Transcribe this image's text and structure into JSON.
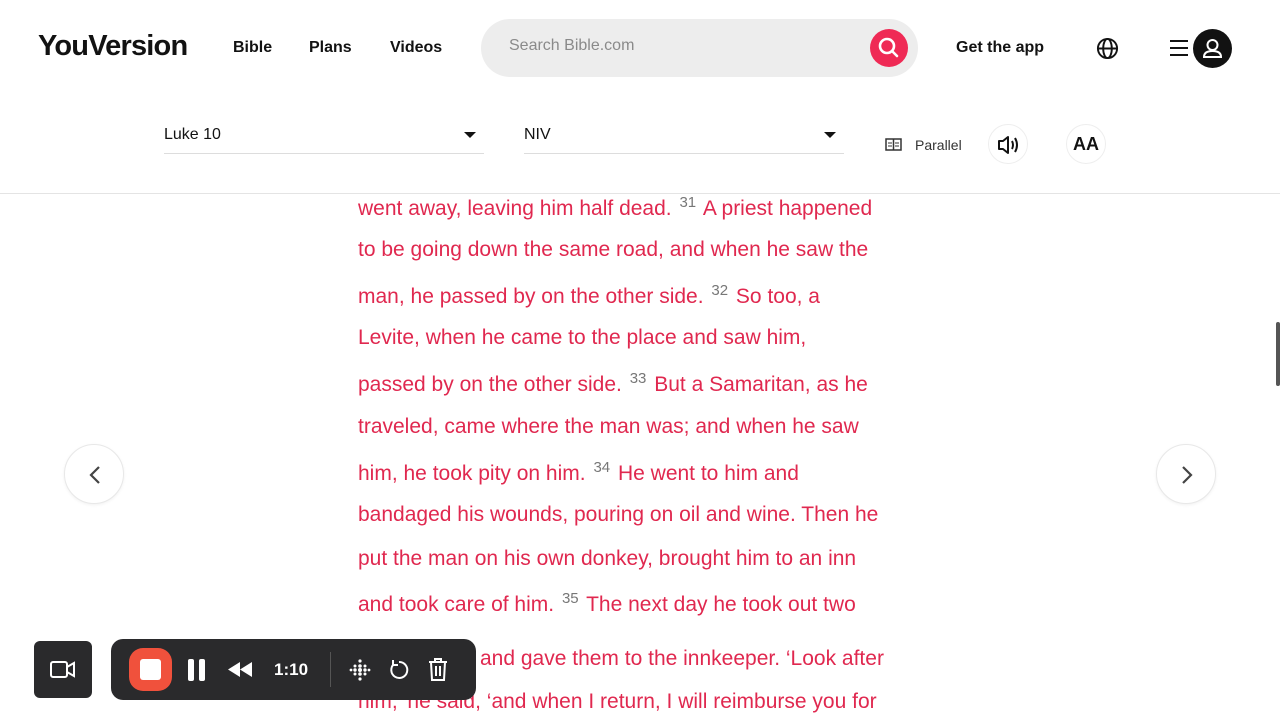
{
  "nav": {
    "logo": "YouVersion",
    "links": [
      "Bible",
      "Plans",
      "Videos"
    ],
    "search_placeholder": "Search Bible.com",
    "get_app": "Get the app"
  },
  "toolbar": {
    "book": "Luke 10",
    "version": "NIV",
    "parallel": "Parallel",
    "font_btn": "AA"
  },
  "colors": {
    "accent": "#ef2a55",
    "text": "#e0284f",
    "verse_num": "#777777"
  },
  "reader": {
    "lines": [
      [
        {
          "t": "went away, leaving him half dead. "
        },
        {
          "v": "31"
        },
        {
          "t": " A priest happened"
        }
      ],
      [
        {
          "t": "to be going down the same road, and when he saw the"
        }
      ],
      [
        {
          "t": "man, he passed by on the other side. "
        },
        {
          "v": "32"
        },
        {
          "t": " So too, a"
        }
      ],
      [
        {
          "t": "Levite, when he came to the place and saw him,"
        }
      ],
      [
        {
          "t": "passed by on the other side. "
        },
        {
          "v": "33"
        },
        {
          "t": " But a Samaritan, as he"
        }
      ],
      [
        {
          "t": "traveled, came where the man was; and when he saw"
        }
      ],
      [
        {
          "t": "him, he took pity on him. "
        },
        {
          "v": "34"
        },
        {
          "t": " He went to him and"
        }
      ],
      [
        {
          "t": "bandaged his wounds, pouring on oil and wine. Then he"
        }
      ],
      [
        {
          "t": "put the man on his own donkey, brought him to an inn"
        }
      ],
      [
        {
          "t": "and took care of him. "
        },
        {
          "v": "35"
        },
        {
          "t": " The next day he took out two"
        }
      ],
      [
        {
          "t": "and gave them to the innkeeper. ‘Look after"
        }
      ],
      [
        {
          "t": "him,’ he said, ‘and when I return, I will reimburse you for"
        }
      ]
    ]
  },
  "recorder": {
    "time": "1:10"
  }
}
